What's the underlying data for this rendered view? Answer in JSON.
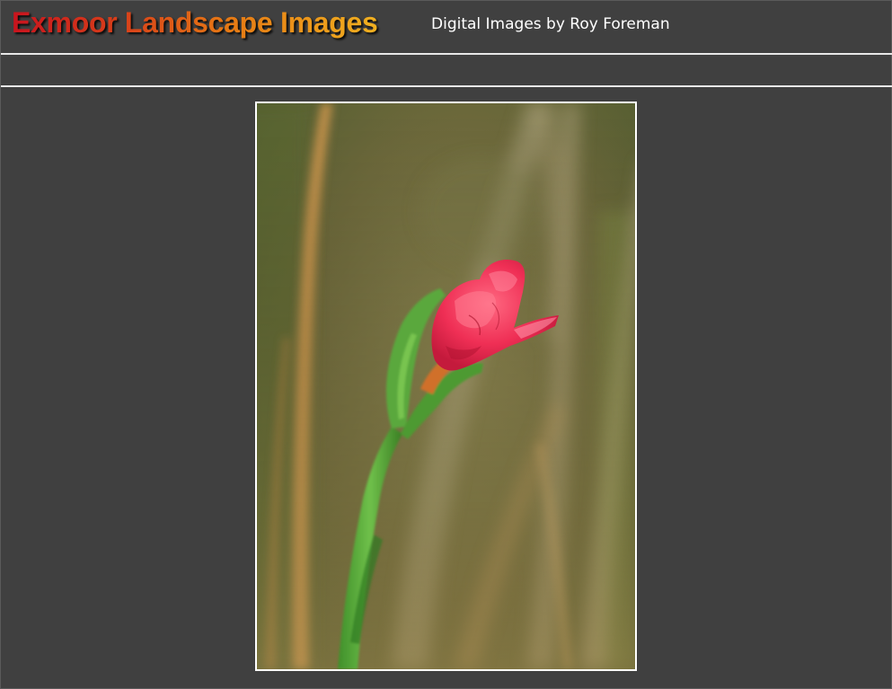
{
  "header": {
    "site_title": "Exmoor Landscape Images",
    "tagline": "Digital Images by Roy Foreman"
  },
  "colors": {
    "background": "#404040",
    "rule": "#e8e8e8",
    "title_gradient_start": "#c8141e",
    "title_gradient_end": "#f0b020",
    "tagline": "#ffffff",
    "photo_border": "#ffffff"
  },
  "photo": {
    "subject": "pink flower bud on green stem with blurred grass background"
  }
}
